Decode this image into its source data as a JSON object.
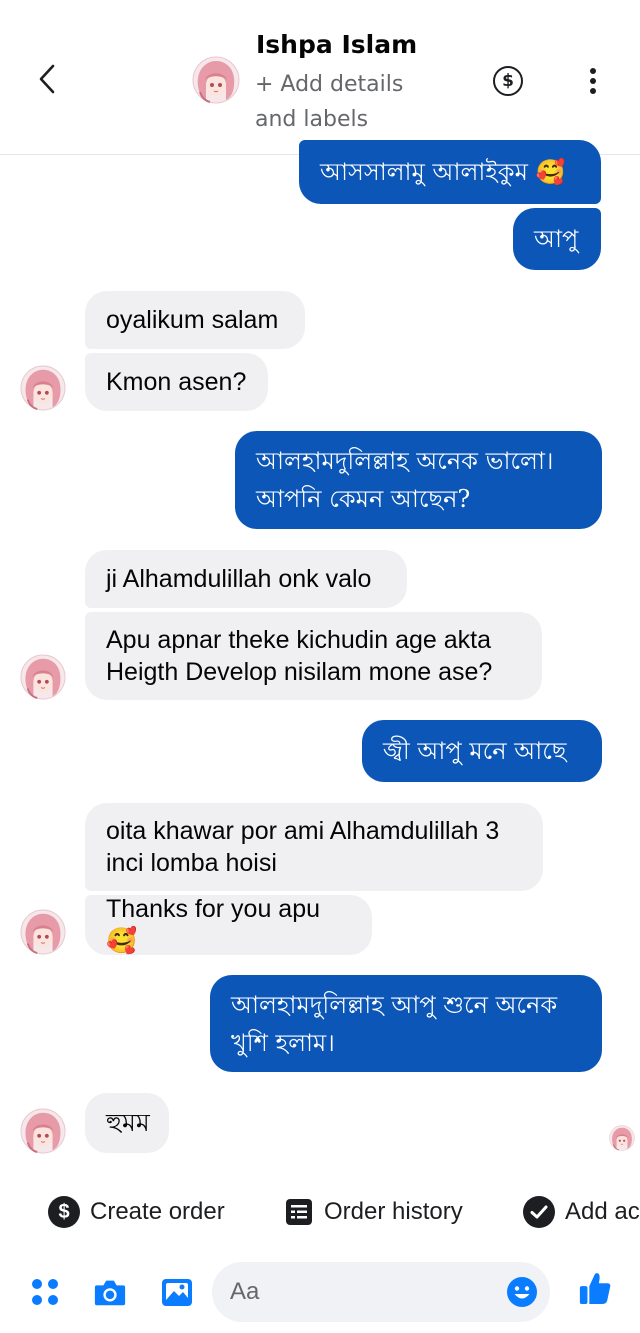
{
  "header": {
    "contact_name": "Ishpa Islam",
    "contact_subtitle": "+ Add details and labels",
    "dollar_symbol": "$"
  },
  "messages": [
    {
      "side": "outgoing",
      "text": "আসসালামু আলাইকুম 🥰"
    },
    {
      "side": "outgoing",
      "text": "আপু"
    },
    {
      "side": "incoming",
      "text": "oyalikum salam"
    },
    {
      "side": "incoming",
      "text": "Kmon asen?"
    },
    {
      "side": "outgoing",
      "text": "আলহামদুলিল্লাহ অনেক ভালো।\nআপনি কেমন আছেন?"
    },
    {
      "side": "incoming",
      "text": "ji Alhamdulillah onk valo"
    },
    {
      "side": "incoming",
      "text": "Apu apnar theke kichudin age akta\nHeigth Develop nisilam mone ase?"
    },
    {
      "side": "outgoing",
      "text": "জ্বী আপু মনে আছে"
    },
    {
      "side": "incoming",
      "text": "oita khawar por ami Alhamdulillah 3\ninci lomba hoisi"
    },
    {
      "side": "incoming",
      "text": "Thanks for you apu🥰"
    },
    {
      "side": "outgoing",
      "text": "আলহামদুলিল্লাহ আপু শুনে অনেক\nখুশি হলাম।"
    },
    {
      "side": "incoming",
      "text": "হুমম"
    }
  ],
  "quick_actions": [
    {
      "label": "Create order",
      "icon": "dollar-circle-icon",
      "symbol": "$"
    },
    {
      "label": "Order history",
      "icon": "receipt-icon"
    },
    {
      "label": "Add ac",
      "icon": "check-circle-icon"
    }
  ],
  "composer": {
    "placeholder": "Aa",
    "icons": [
      "apps-icon",
      "camera-icon",
      "gallery-icon",
      "emoji-icon",
      "like-icon"
    ]
  },
  "colors": {
    "outgoing_bubble": "#0b56b6",
    "incoming_bubble": "#f0f0f3",
    "accent": "#0a7cff"
  }
}
